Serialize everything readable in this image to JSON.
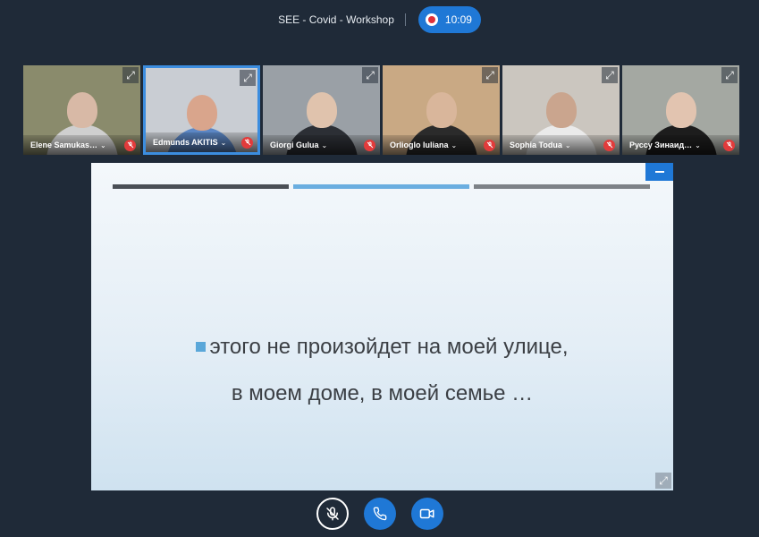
{
  "meeting": {
    "title": "SEE - Covid - Workshop",
    "recording_time": "10:09"
  },
  "participants": [
    {
      "name": "Elene Samukas…",
      "active": false,
      "bg": "#8a8b6c",
      "skin": "#d8b9a6",
      "shirt": "#cfcfcf"
    },
    {
      "name": "Edmunds AKITIS",
      "active": true,
      "bg": "#c9cdd3",
      "skin": "#d9a58c",
      "shirt": "#5b86c4"
    },
    {
      "name": "Giorgi Gulua",
      "active": false,
      "bg": "#9aa0a6",
      "skin": "#e0c3ad",
      "shirt": "#2c2f35"
    },
    {
      "name": "Orlioglo Iuliana",
      "active": false,
      "bg": "#c9a984",
      "skin": "#d9b69b",
      "shirt": "#2b2b2b"
    },
    {
      "name": "Sophia Todua",
      "active": false,
      "bg": "#cbc6bf",
      "skin": "#caa58e",
      "shirt": "#eaeaea"
    },
    {
      "name": "Руссу Зинаид…",
      "active": false,
      "bg": "#a4a8a2",
      "skin": "#e2c4b0",
      "shirt": "#1d1d1d"
    }
  ],
  "slide": {
    "progress_segments": [
      "#4a4f55",
      "#6aaee0",
      "#7d8287"
    ],
    "line1": "этого не произойдет на моей улице,",
    "line2": "в моем доме, в моей семье …"
  },
  "icons": {
    "tile_expand": "expand-icon",
    "muted": "mic-off-icon",
    "controls": [
      "mic-off-icon",
      "phone-icon",
      "video-camera-icon"
    ]
  },
  "colors": {
    "accent": "#1f78d6",
    "background": "#1f2a38",
    "mute": "#e23b3b"
  }
}
